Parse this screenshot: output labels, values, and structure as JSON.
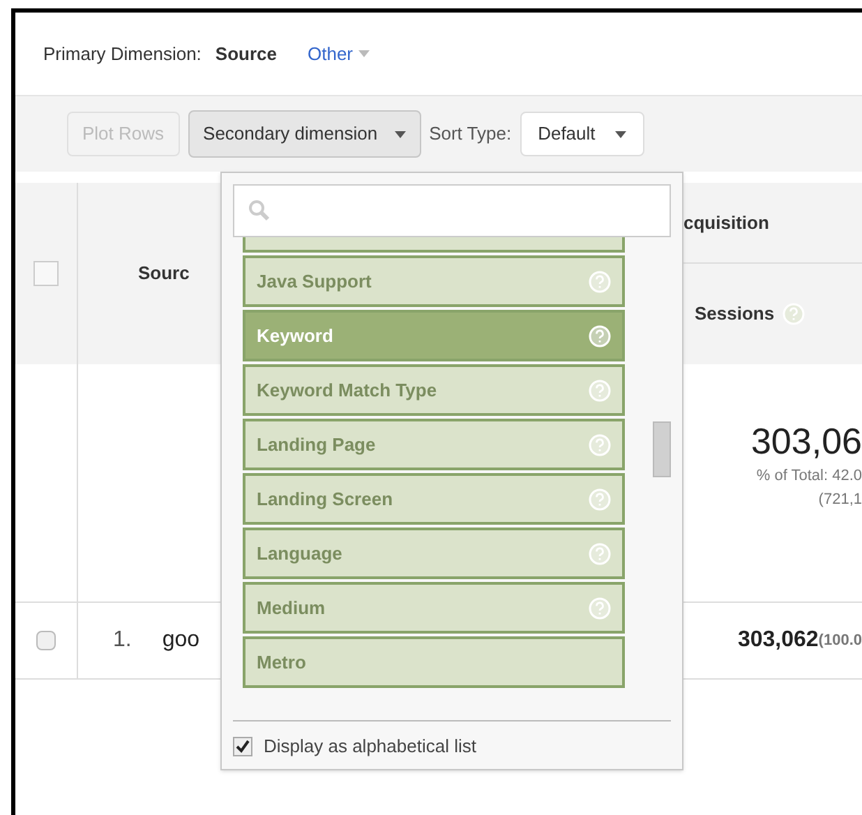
{
  "primary_dimension": {
    "label": "Primary Dimension:",
    "options": [
      {
        "label": "Source",
        "selected": true
      },
      {
        "label": "Other",
        "selected": false
      }
    ]
  },
  "toolbar": {
    "plot_rows": {
      "label": "Plot Rows",
      "disabled": true
    },
    "secondary_dimension": {
      "label": "Secondary dimension",
      "expanded": true
    },
    "sort_type": {
      "label": "Sort Type:",
      "value": "Default"
    }
  },
  "table": {
    "header": {
      "source": "Sourc",
      "group": "cquisition",
      "metric": "Sessions"
    },
    "totals": {
      "value": "303,06",
      "share": "% of Total: 42.0",
      "total": "(721,1"
    },
    "select_all": {
      "checked": false
    },
    "rows": [
      {
        "checked": false,
        "index": "1.",
        "source": "goo",
        "value": "303,062",
        "share": "(100.0"
      }
    ]
  },
  "dropdown": {
    "items": [
      {
        "label": "Java Support",
        "help": true,
        "selected": false
      },
      {
        "label": "Keyword",
        "help": true,
        "selected": true
      },
      {
        "label": "Keyword Match Type",
        "help": true,
        "selected": false
      },
      {
        "label": "Landing Page",
        "help": true,
        "selected": false
      },
      {
        "label": "Landing Screen",
        "help": true,
        "selected": false
      },
      {
        "label": "Language",
        "help": true,
        "selected": false
      },
      {
        "label": "Medium",
        "help": true,
        "selected": false
      },
      {
        "label": "Metro",
        "help": false,
        "selected": false
      }
    ],
    "alphabetical": {
      "label": "Display as alphabetical list",
      "checked": true
    }
  }
}
